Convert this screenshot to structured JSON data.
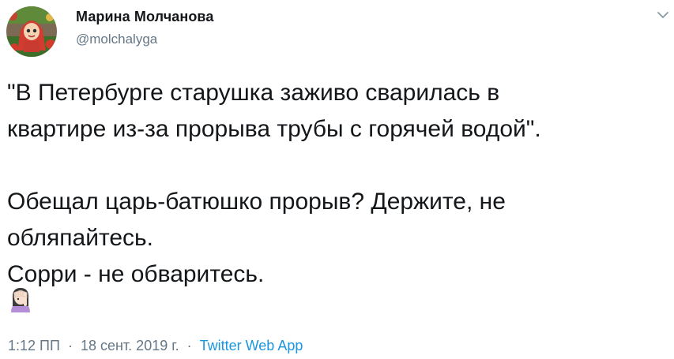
{
  "author": {
    "display_name": "Марина Молчанова",
    "handle": "@molchalyga",
    "avatar_icon": "cartoon-girl-avatar"
  },
  "menu": {
    "caret_icon": "chevron-down-icon"
  },
  "tweet": {
    "lines": [
      "\"В Петербурге старушка заживо сварилась в",
      "квартире из-за прорыва трубы с горячей водой\".",
      "",
      "Обещал царь-батюшко прорыв? Держите, не",
      "обляпайтесь.",
      "Сорри - не обваритесь."
    ],
    "emoji": "woman-facepalming-emoji"
  },
  "meta": {
    "time": "1:12 ПП",
    "separator": "·",
    "date": "18 сент. 2019 г.",
    "via": "Twitter Web App"
  },
  "colors": {
    "text": "#14171a",
    "secondary": "#657786",
    "link": "#1b95e0"
  }
}
